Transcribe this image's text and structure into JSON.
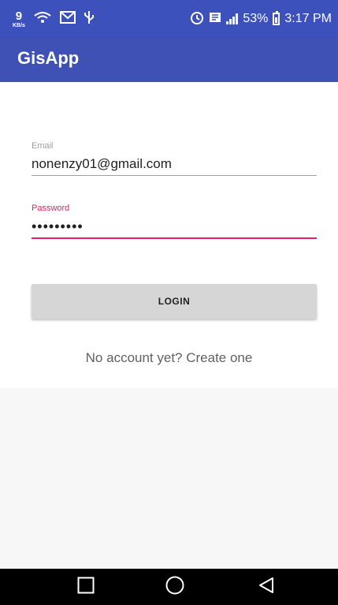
{
  "status_bar": {
    "kbs_value": "9",
    "kbs_unit": "KB/s",
    "battery": "53%",
    "time": "3:17 PM",
    "icons": [
      "wifi-data-icon",
      "mail-icon",
      "usb-icon",
      "alarm-icon",
      "roaming-icon",
      "signal-icon",
      "battery-icon"
    ]
  },
  "app_bar": {
    "title": "GisApp"
  },
  "form": {
    "email": {
      "label": "Email",
      "value": "nonenzy01@gmail.com"
    },
    "password": {
      "label": "Password",
      "value": "•••••••••"
    },
    "login_label": "LOGIN",
    "create_account": "No account yet? Create one"
  },
  "colors": {
    "primary": "#3f51b5",
    "status_bar": "#3c51bb",
    "accent": "#e91e63",
    "button": "#d6d6d6"
  },
  "nav_bar": {
    "buttons": [
      "recent-apps-icon",
      "home-icon",
      "back-icon"
    ]
  }
}
